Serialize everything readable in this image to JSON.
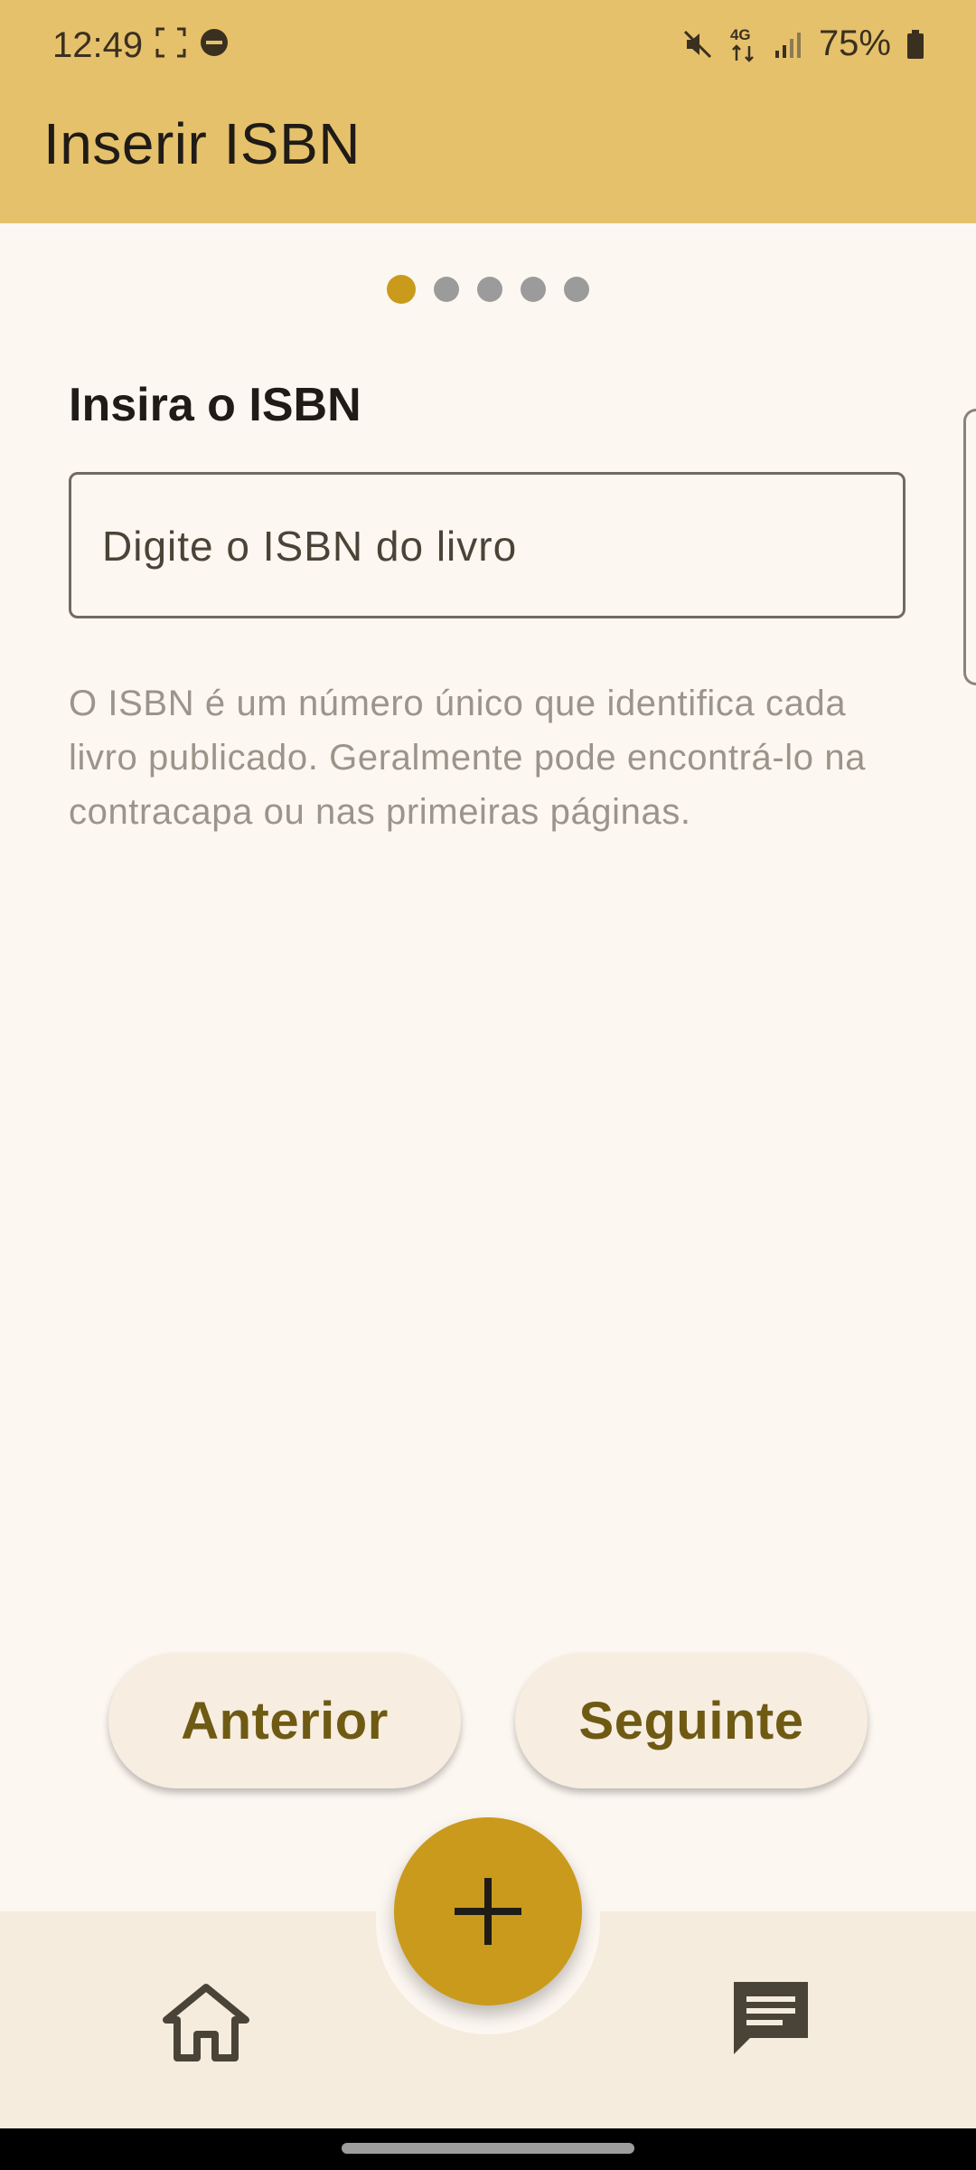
{
  "status_bar": {
    "time": "12:49",
    "battery_percent": "75%",
    "network_label": "4G",
    "icons": [
      "screenshot-icon",
      "do-not-disturb-icon",
      "mute-icon",
      "network-4g-icon",
      "signal-icon",
      "battery-icon"
    ]
  },
  "app_bar": {
    "title": "Inserir ISBN"
  },
  "pager": {
    "total_steps": 5,
    "current_step": 1
  },
  "form": {
    "heading": "Insira o ISBN",
    "isbn_input": {
      "placeholder": "Digite o ISBN do livro",
      "value": ""
    },
    "helper_text": "O ISBN é um número único que identifica cada livro publicado. Geralmente pode encontrá-lo na contracapa ou nas primeiras páginas."
  },
  "actions": {
    "previous_label": "Anterior",
    "next_label": "Seguinte"
  },
  "bottom_nav": {
    "items": [
      {
        "icon": "home-icon"
      },
      {
        "icon": "add-icon"
      },
      {
        "icon": "chat-icon"
      }
    ]
  },
  "colors": {
    "app_bar": "#e6c16b",
    "accent": "#c99a1c",
    "background": "#fdf7f1",
    "button_text": "#6f5a14",
    "nav_background": "#f5ecde"
  }
}
